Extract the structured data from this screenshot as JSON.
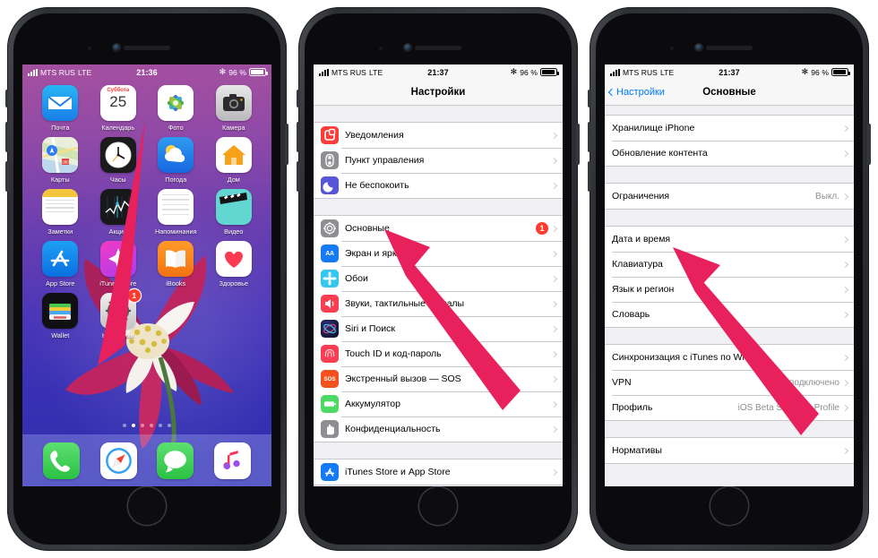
{
  "accent": {
    "arrow": "#E8215C",
    "ios_blue": "#007aff",
    "badge_red": "#ff3b30",
    "gray": "#8e8e93"
  },
  "phones": [
    {
      "id": "phone-home-screen",
      "status": {
        "carrier": "MTS RUS",
        "network": "LTE",
        "time": "21:36",
        "battery": "96 %"
      },
      "home": {
        "apps": [
          {
            "name": "Почта",
            "icon": "mail-icon"
          },
          {
            "name": "Календарь",
            "icon": "calendar-icon",
            "day_name": "Суббота",
            "day_number": "25"
          },
          {
            "name": "Фото",
            "icon": "photos-icon"
          },
          {
            "name": "Камера",
            "icon": "camera-icon"
          },
          {
            "name": "Карты",
            "icon": "maps-icon"
          },
          {
            "name": "Часы",
            "icon": "clock-icon"
          },
          {
            "name": "Погода",
            "icon": "weather-icon"
          },
          {
            "name": "Дом",
            "icon": "home-icon"
          },
          {
            "name": "Заметки",
            "icon": "notes-icon"
          },
          {
            "name": "Акции",
            "icon": "stocks-icon"
          },
          {
            "name": "Напоминания",
            "icon": "reminders-icon"
          },
          {
            "name": "Видео",
            "icon": "videos-icon"
          },
          {
            "name": "App Store",
            "icon": "appstore-icon"
          },
          {
            "name": "iTunes Store",
            "icon": "itunes-icon"
          },
          {
            "name": "iBooks",
            "icon": "ibooks-icon"
          },
          {
            "name": "Здоровье",
            "icon": "health-icon"
          },
          {
            "name": "Wallet",
            "icon": "wallet-icon"
          },
          {
            "name": "Настройки",
            "icon": "settings-gear-icon",
            "badge": "1"
          }
        ],
        "page_dots": {
          "count": 6,
          "active_index": 1
        },
        "dock": [
          {
            "name": "Телефон",
            "icon": "phone-icon"
          },
          {
            "name": "Safari",
            "icon": "safari-icon"
          },
          {
            "name": "Сообщения",
            "icon": "messages-icon"
          },
          {
            "name": "Музыка",
            "icon": "music-icon"
          }
        ]
      }
    },
    {
      "id": "phone-settings",
      "status": {
        "carrier": "MTS RUS",
        "network": "LTE",
        "time": "21:37",
        "battery": "96 %"
      },
      "nav": {
        "title": "Настройки"
      },
      "groups": [
        {
          "rows": [
            {
              "label": "Уведомления",
              "icon": "notifications-icon"
            },
            {
              "label": "Пункт управления",
              "icon": "control-center-icon"
            },
            {
              "label": "Не беспокоить",
              "icon": "do-not-disturb-icon"
            }
          ]
        },
        {
          "rows": [
            {
              "label": "Основные",
              "icon": "general-gear-icon",
              "badge": "1"
            },
            {
              "label": "Экран и яркость",
              "icon": "display-brightness-icon"
            },
            {
              "label": "Обои",
              "icon": "wallpaper-icon"
            },
            {
              "label": "Звуки, тактильные сигналы",
              "icon": "sounds-icon"
            },
            {
              "label": "Siri и Поиск",
              "icon": "siri-icon"
            },
            {
              "label": "Touch ID и код-пароль",
              "icon": "touchid-icon"
            },
            {
              "label": "Экстренный вызов — SOS",
              "icon": "sos-icon"
            },
            {
              "label": "Аккумулятор",
              "icon": "battery-icon"
            },
            {
              "label": "Конфиденциальность",
              "icon": "privacy-icon"
            }
          ]
        },
        {
          "rows": [
            {
              "label": "iTunes Store и App Store",
              "icon": "appstore-blue-icon"
            }
          ]
        }
      ]
    },
    {
      "id": "phone-general",
      "status": {
        "carrier": "MTS RUS",
        "network": "LTE",
        "time": "21:37",
        "battery": "96 %"
      },
      "nav": {
        "back": "Настройки",
        "title": "Основные"
      },
      "groups": [
        {
          "rows": [
            {
              "label": "Хранилище iPhone"
            },
            {
              "label": "Обновление контента"
            }
          ]
        },
        {
          "rows": [
            {
              "label": "Ограничения",
              "value": "Выкл."
            }
          ]
        },
        {
          "rows": [
            {
              "label": "Дата и время"
            },
            {
              "label": "Клавиатура"
            },
            {
              "label": "Язык и регион"
            },
            {
              "label": "Словарь"
            }
          ]
        },
        {
          "rows": [
            {
              "label": "Синхронизация с iTunes по Wi-Fi"
            },
            {
              "label": "VPN",
              "value": "Не подключено"
            },
            {
              "label": "Профиль",
              "value": "iOS Beta Software Profile"
            }
          ]
        },
        {
          "rows": [
            {
              "label": "Нормативы"
            }
          ]
        }
      ]
    }
  ],
  "annotations": [
    {
      "name": "arrow-to-settings-app",
      "target": "Настройки"
    },
    {
      "name": "arrow-to-general-row",
      "target": "Основные"
    },
    {
      "name": "arrow-to-date-time-row",
      "target": "Дата и время"
    }
  ]
}
